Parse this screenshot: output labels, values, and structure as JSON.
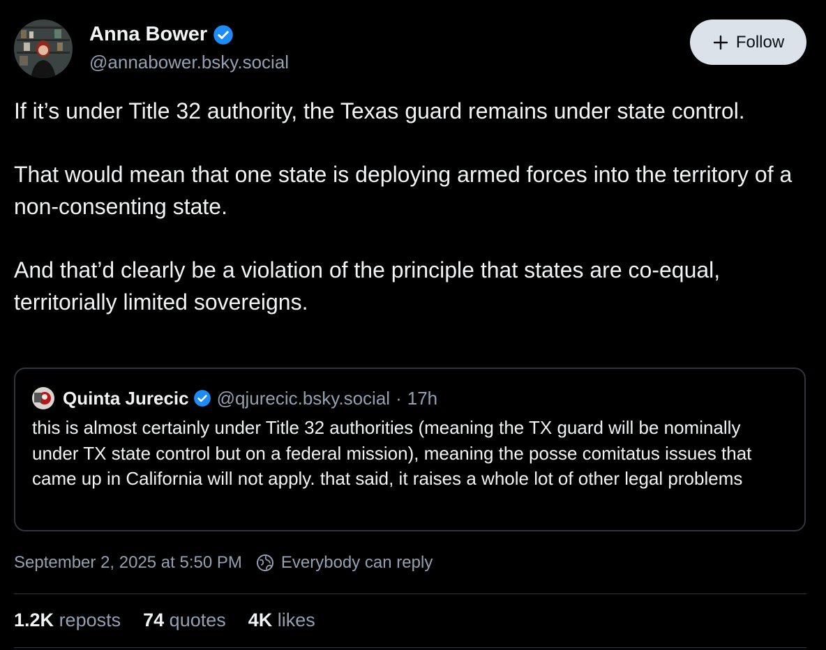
{
  "author": {
    "name": "Anna Bower",
    "handle": "@annabower.bsky.social",
    "verified": true
  },
  "follow_button": {
    "icon": "plus-icon",
    "label": "Follow"
  },
  "post": {
    "paragraphs": [
      "If it’s under Title 32 authority, the Texas guard remains under state control.",
      "That would mean that one state is deploying armed forces into the territory of a non-consenting state.",
      "And that’d clearly be a violation of the principle that states are co-equal, territorially limited sovereigns."
    ],
    "timestamp": "September 2, 2025 at 5:50 PM",
    "reply_setting": "Everybody can reply"
  },
  "quote": {
    "name": "Quinta Jurecic",
    "handle": "@qjurecic.bsky.social",
    "separator": "·",
    "time": "17h",
    "verified": true,
    "text": "this is almost certainly under Title 32 authorities (meaning the TX guard will be nominally under TX state control but on a federal mission), meaning the posse comitatus issues that came up in California will not apply. that said, it raises a whole lot of other legal problems"
  },
  "stats": {
    "reposts": {
      "count": "1.2K",
      "label": "reposts"
    },
    "quotes": {
      "count": "74",
      "label": "quotes"
    },
    "likes": {
      "count": "4K",
      "label": "likes"
    }
  },
  "colors": {
    "background": "#000000",
    "text": "#f1f3f5",
    "muted": "#93a1b1",
    "verified": "#1d8cf8",
    "border": "#2e3640",
    "button_bg": "#dce2ea"
  },
  "icons": {
    "verified": "verified-check-icon",
    "follow": "plus-icon",
    "reply_setting": "globe-icon"
  }
}
